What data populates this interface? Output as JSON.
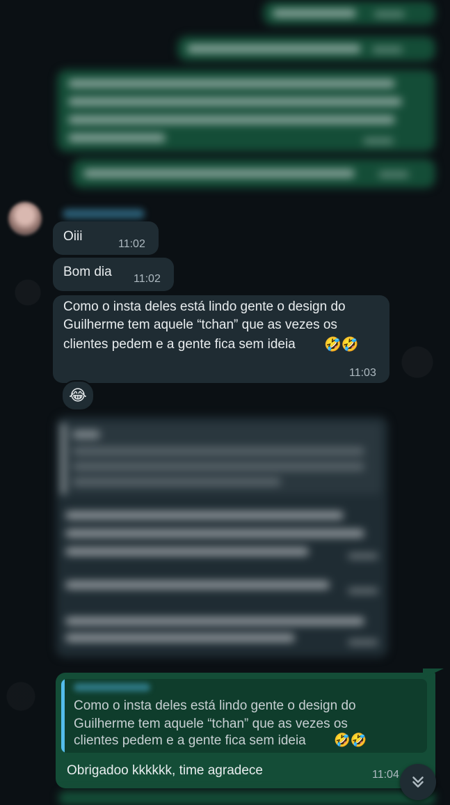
{
  "incoming_messages": [
    {
      "text": "Oiii",
      "time": "11:02"
    },
    {
      "text": "Bom dia",
      "time": "11:02"
    },
    {
      "text_lines": [
        "Como o insta deles está lindo gente o design do",
        "Guilherme tem aquele “tchan” que as vezes os",
        "clientes pedem e a gente fica sem ideia"
      ],
      "emoji": "🤣🤣",
      "time": "11:03",
      "reaction": "😂"
    }
  ],
  "reply": {
    "quoted_lines": [
      "Como o insta deles está lindo gente o design do",
      "Guilherme tem aquele “tchan” que as vezes os",
      "clientes pedem e a gente fica sem ideia"
    ],
    "quoted_emoji": "🤣🤣",
    "text": "Obrigadoo kkkkkk, time agradece",
    "time": "11:04"
  },
  "icons": {
    "scroll_down": "double-chevron-down-icon",
    "reaction": "laughing-emoji"
  },
  "colors": {
    "outgoing_bubble": "#144d37",
    "incoming_bubble": "#1f2c33",
    "background": "#0b1014",
    "quote_bar": "#53bdeb"
  }
}
